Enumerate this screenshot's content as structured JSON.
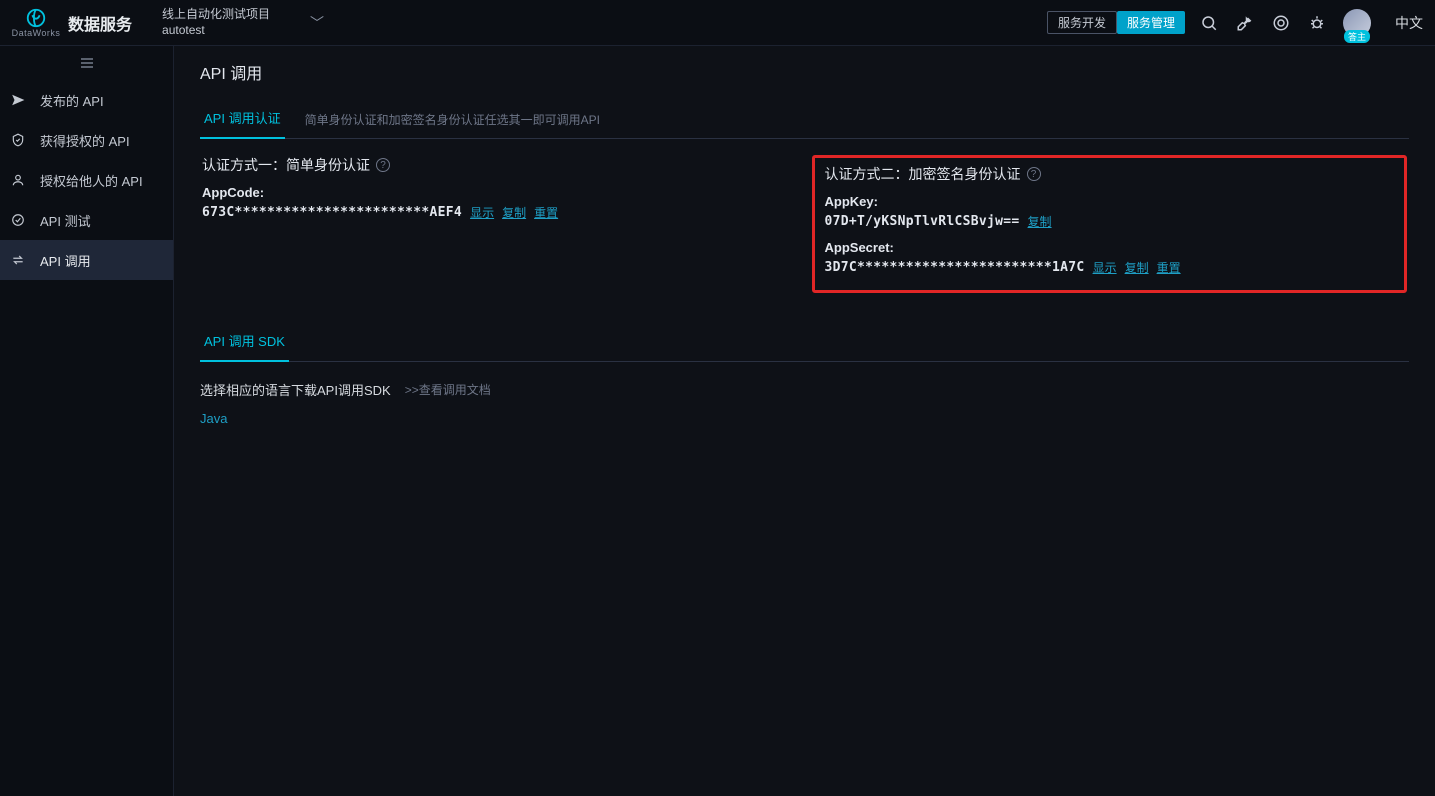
{
  "header": {
    "brand": "DataWorks",
    "app_title": "数据服务",
    "project_line1": "线上自动化测试项目",
    "project_line2": "autotest",
    "nav_dev": "服务开发",
    "nav_mgmt": "服务管理",
    "user_badge": "答主",
    "lang": "中文"
  },
  "sidebar": {
    "items": [
      "发布的 API",
      "获得授权的 API",
      "授权给他人的 API",
      "API 测试",
      "API 调用"
    ]
  },
  "page": {
    "title": "API 调用",
    "tab_auth": "API 调用认证",
    "tab_auth_note": "简单身份认证和加密签名身份认证任选其一即可调用API",
    "auth1_title": "认证方式一：简单身份认证",
    "appcode_label": "AppCode:",
    "appcode_value": "673C************************AEF4",
    "show": "显示",
    "copy": "复制",
    "reset": "重置",
    "auth2_title": "认证方式二：加密签名身份认证",
    "appkey_label": "AppKey:",
    "appkey_value": "07D+T/yKSNpTlvRlCSBvjw==",
    "appsecret_label": "AppSecret:",
    "appsecret_value": "3D7C************************1A7C",
    "sdk_tab": "API 调用 SDK",
    "sdk_prompt": "选择相应的语言下载API调用SDK",
    "sdk_doc_link": ">>查看调用文档",
    "java": "Java"
  }
}
